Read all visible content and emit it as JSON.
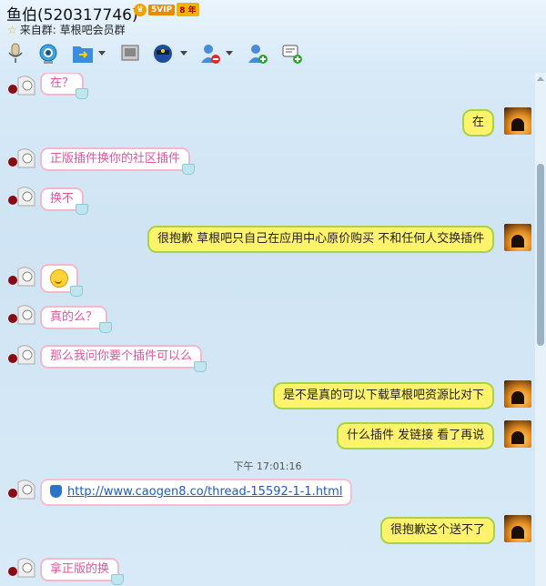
{
  "header": {
    "title": "鱼伯(520317746)",
    "vip_level": "5VIP",
    "vip_years": "8 年",
    "subtitle_prefix": "来自群:",
    "group_name": "草根吧会员群"
  },
  "toolbar": {
    "icons": [
      "microphone-icon",
      "video-camera-icon",
      "send-file-icon",
      "screen-share-icon",
      "police-avatar-icon",
      "remove-member-icon",
      "add-member-icon",
      "add-chat-icon"
    ]
  },
  "messages": [
    {
      "side": "left",
      "text": "在？"
    },
    {
      "side": "right",
      "text": "在"
    },
    {
      "side": "left",
      "text": "正版插件换你的社区插件"
    },
    {
      "side": "left",
      "text": "换不"
    },
    {
      "side": "right",
      "text": "很抱歉 草根吧只自己在应用中心原价购买 不和任何人交换插件"
    },
    {
      "side": "left",
      "text": "",
      "emoji": "smirk-face"
    },
    {
      "side": "left",
      "text": "真的么？"
    },
    {
      "side": "left",
      "text": "那么我问你要个插件可以么"
    },
    {
      "side": "right",
      "text": "是不是真的可以下载草根吧资源比对下"
    },
    {
      "side": "right",
      "text": "什么插件 发链接 看了再说"
    },
    {
      "side": "left",
      "text": "http://www.caogen8.co/thread-15592-1-1.html",
      "link": true
    },
    {
      "side": "right",
      "text": "很抱歉这个送不了"
    },
    {
      "side": "left",
      "text": "拿正版的换"
    }
  ],
  "timestamp": "下午 17:01:16",
  "colors": {
    "left_bubble_border": "#f4b8cc",
    "left_text": "#e0549a",
    "right_bubble_fill": "#fff36b",
    "right_bubble_border": "#a8d24a",
    "link": "#1a5bc8"
  }
}
